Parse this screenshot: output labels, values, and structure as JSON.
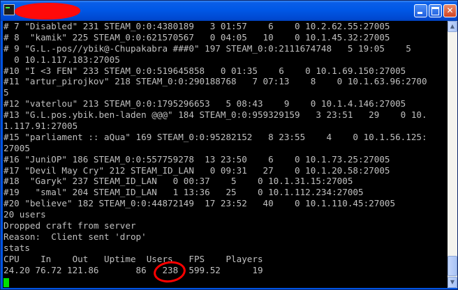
{
  "window": {
    "title": "",
    "controls": {
      "minimize": "",
      "maximize": "",
      "close": "✕"
    }
  },
  "console": {
    "lines": [
      "# 7 \"Disabled\" 231 STEAM_0:0:4380189   3 01:57    6    0 10.2.62.55:27005",
      "# 8  \"kamik\" 225 STEAM_0:0:621570567   0 04:05   10    0 10.1.45.32:27005",
      "# 9 \"G.L.-pos//ybik@-Chupakabra ###0\" 197 STEAM_0:0:2111674748   5 19:05    5",
      "  0 10.1.117.183:27005",
      "#10 \"I <3 FEN\" 233 STEAM_0:0:519645858   0 01:35    6    0 10.1.69.150:27005",
      "#11 \"artur_pirojkov\" 218 STEAM_0:0:290188768   7 07:13    8    0 10.1.63.96:2700",
      "5",
      "#12 \"vaterlou\" 213 STEAM_0:0:1795296653   5 08:43    9    0 10.1.4.146:27005",
      "#13 \"G.L.pos.ybik.ben-laden @@@\" 184 STEAM_0:0:959329159   3 23:51   29    0 10.",
      "1.117.91:27005",
      "#15 \"parliament :: aQua\" 169 STEAM_0:0:95282152   8 23:55    4    0 10.1.56.125:",
      "27005",
      "#16 \"JuniOP\" 186 STEAM_0:0:557759278  13 23:50    6    0 10.1.73.25:27005",
      "#17 \"Devil May Cry\" 212 STEAM_ID_LAN   0 09:31   27    0 10.1.20.58:27005",
      "#18  \"Garyk\" 237 STEAM_ID_LAN   0 00:37    5    0 10.1.31.15:27005",
      "#19   \"smal\" 204 STEAM_ID_LAN   1 13:36   25    0 10.1.112.234:27005",
      "#20 \"believe\" 182 STEAM_0:0:44872149  17 23:52   40    0 10.1.110.45:27005",
      "20 users",
      "Dropped craft from server",
      "Reason:  Client sent 'drop'",
      "stats",
      "CPU    In    Out   Uptime  Users   FPS    Players",
      "24.20 76.72 121.86       86   238  599.52      19"
    ]
  },
  "colors": {
    "console_bg": "#000000",
    "console_text": "#c0c0c0",
    "cursor": "#00e000",
    "titlebar": "#0058e6",
    "annotation": "#ff0000"
  },
  "icons": {
    "app": "terminal-icon",
    "minimize": "minimize-icon",
    "maximize": "maximize-icon",
    "close": "close-icon"
  }
}
